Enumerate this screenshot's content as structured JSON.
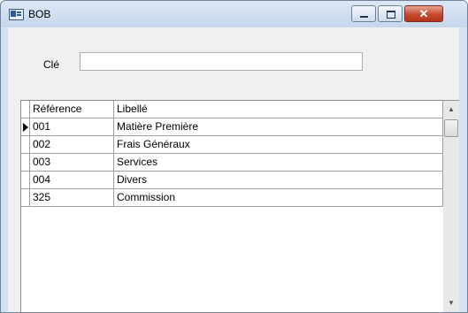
{
  "window": {
    "title": "BOB",
    "icon": "app-icon",
    "controls": {
      "minimize_icon": "minimize-icon",
      "maximize_icon": "maximize-icon",
      "close_label": "✕"
    }
  },
  "search": {
    "label": "Clé",
    "value": "",
    "placeholder": ""
  },
  "grid": {
    "columns": [
      "Référence",
      "Libellé"
    ],
    "rows": [
      {
        "ref": "001",
        "label": "Matière Première",
        "current": true
      },
      {
        "ref": "002",
        "label": "Frais Généraux",
        "current": false
      },
      {
        "ref": "003",
        "label": "Services",
        "current": false
      },
      {
        "ref": "004",
        "label": "Divers",
        "current": false
      },
      {
        "ref": "325",
        "label": "Commission",
        "current": false
      }
    ],
    "scroll_up": "▲",
    "scroll_down": "▼"
  },
  "colors": {
    "titlebar": "#c6d7ec",
    "close_button": "#c54a32",
    "grid_line": "#a0a0a0"
  }
}
